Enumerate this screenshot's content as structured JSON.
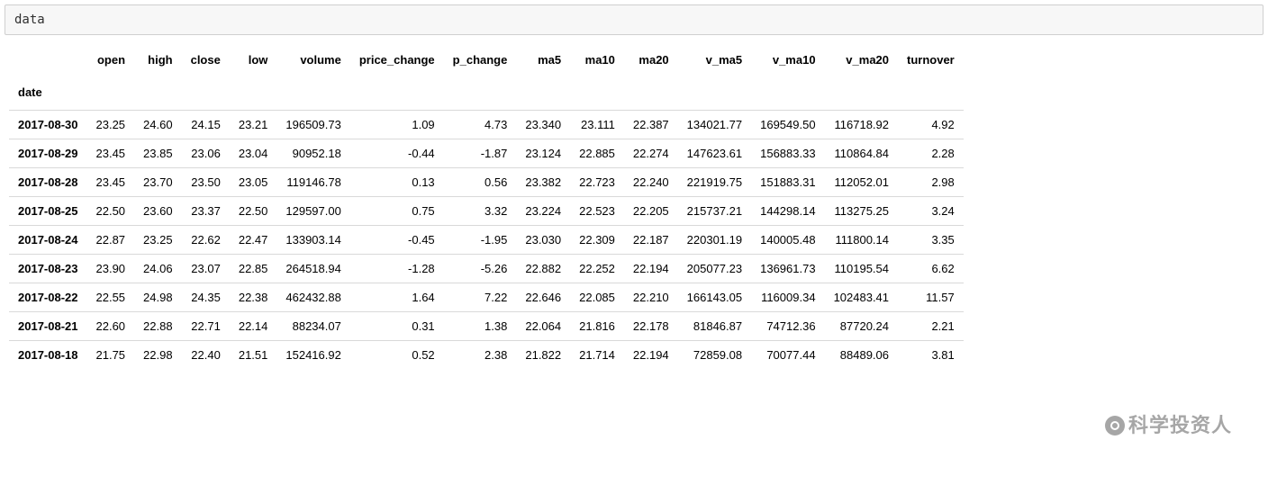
{
  "cell_input": "data",
  "index_name": "date",
  "columns": [
    "open",
    "high",
    "close",
    "low",
    "volume",
    "price_change",
    "p_change",
    "ma5",
    "ma10",
    "ma20",
    "v_ma5",
    "v_ma10",
    "v_ma20",
    "turnover"
  ],
  "rows": [
    {
      "date": "2017-08-30",
      "open": "23.25",
      "high": "24.60",
      "close": "24.15",
      "low": "23.21",
      "volume": "196509.73",
      "price_change": "1.09",
      "p_change": "4.73",
      "ma5": "23.340",
      "ma10": "23.111",
      "ma20": "22.387",
      "v_ma5": "134021.77",
      "v_ma10": "169549.50",
      "v_ma20": "116718.92",
      "turnover": "4.92"
    },
    {
      "date": "2017-08-29",
      "open": "23.45",
      "high": "23.85",
      "close": "23.06",
      "low": "23.04",
      "volume": "90952.18",
      "price_change": "-0.44",
      "p_change": "-1.87",
      "ma5": "23.124",
      "ma10": "22.885",
      "ma20": "22.274",
      "v_ma5": "147623.61",
      "v_ma10": "156883.33",
      "v_ma20": "110864.84",
      "turnover": "2.28"
    },
    {
      "date": "2017-08-28",
      "open": "23.45",
      "high": "23.70",
      "close": "23.50",
      "low": "23.05",
      "volume": "119146.78",
      "price_change": "0.13",
      "p_change": "0.56",
      "ma5": "23.382",
      "ma10": "22.723",
      "ma20": "22.240",
      "v_ma5": "221919.75",
      "v_ma10": "151883.31",
      "v_ma20": "112052.01",
      "turnover": "2.98"
    },
    {
      "date": "2017-08-25",
      "open": "22.50",
      "high": "23.60",
      "close": "23.37",
      "low": "22.50",
      "volume": "129597.00",
      "price_change": "0.75",
      "p_change": "3.32",
      "ma5": "23.224",
      "ma10": "22.523",
      "ma20": "22.205",
      "v_ma5": "215737.21",
      "v_ma10": "144298.14",
      "v_ma20": "113275.25",
      "turnover": "3.24"
    },
    {
      "date": "2017-08-24",
      "open": "22.87",
      "high": "23.25",
      "close": "22.62",
      "low": "22.47",
      "volume": "133903.14",
      "price_change": "-0.45",
      "p_change": "-1.95",
      "ma5": "23.030",
      "ma10": "22.309",
      "ma20": "22.187",
      "v_ma5": "220301.19",
      "v_ma10": "140005.48",
      "v_ma20": "111800.14",
      "turnover": "3.35"
    },
    {
      "date": "2017-08-23",
      "open": "23.90",
      "high": "24.06",
      "close": "23.07",
      "low": "22.85",
      "volume": "264518.94",
      "price_change": "-1.28",
      "p_change": "-5.26",
      "ma5": "22.882",
      "ma10": "22.252",
      "ma20": "22.194",
      "v_ma5": "205077.23",
      "v_ma10": "136961.73",
      "v_ma20": "110195.54",
      "turnover": "6.62"
    },
    {
      "date": "2017-08-22",
      "open": "22.55",
      "high": "24.98",
      "close": "24.35",
      "low": "22.38",
      "volume": "462432.88",
      "price_change": "1.64",
      "p_change": "7.22",
      "ma5": "22.646",
      "ma10": "22.085",
      "ma20": "22.210",
      "v_ma5": "166143.05",
      "v_ma10": "116009.34",
      "v_ma20": "102483.41",
      "turnover": "11.57"
    },
    {
      "date": "2017-08-21",
      "open": "22.60",
      "high": "22.88",
      "close": "22.71",
      "low": "22.14",
      "volume": "88234.07",
      "price_change": "0.31",
      "p_change": "1.38",
      "ma5": "22.064",
      "ma10": "21.816",
      "ma20": "22.178",
      "v_ma5": "81846.87",
      "v_ma10": "74712.36",
      "v_ma20": "87720.24",
      "turnover": "2.21"
    },
    {
      "date": "2017-08-18",
      "open": "21.75",
      "high": "22.98",
      "close": "22.40",
      "low": "21.51",
      "volume": "152416.92",
      "price_change": "0.52",
      "p_change": "2.38",
      "ma5": "21.822",
      "ma10": "21.714",
      "ma20": "22.194",
      "v_ma5": "72859.08",
      "v_ma10": "70077.44",
      "v_ma20": "88489.06",
      "turnover": "3.81"
    }
  ],
  "watermark": "科学投资人"
}
